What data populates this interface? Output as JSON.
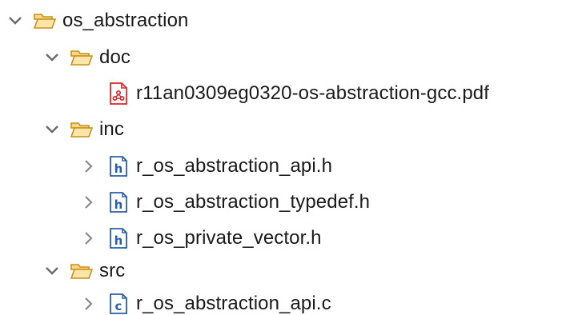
{
  "tree": {
    "root": {
      "name": "os_abstraction",
      "expanded": true,
      "icon": "folder-open-icon",
      "children": [
        {
          "name": "doc",
          "expanded": true,
          "icon": "folder-open-icon",
          "children": [
            {
              "name": "r11an0309eg0320-os-abstraction-gcc.pdf",
              "icon": "pdf-file-icon"
            }
          ]
        },
        {
          "name": "inc",
          "expanded": true,
          "icon": "folder-open-icon",
          "children": [
            {
              "name": "r_os_abstraction_api.h",
              "expanded": false,
              "icon": "h-file-icon"
            },
            {
              "name": "r_os_abstraction_typedef.h",
              "expanded": false,
              "icon": "h-file-icon"
            },
            {
              "name": "r_os_private_vector.h",
              "expanded": false,
              "icon": "h-file-icon"
            }
          ]
        },
        {
          "name": "src",
          "expanded": true,
          "icon": "folder-open-icon",
          "children": [
            {
              "name": "r_os_abstraction_api.c",
              "expanded": false,
              "icon": "c-file-icon"
            }
          ]
        }
      ]
    }
  },
  "colors": {
    "chevron": "#6b6b6b",
    "folder_fill": "#f7d889",
    "folder_stroke": "#c98f1c",
    "pdf_red": "#d9262b",
    "header_blue": "#2a5da8"
  }
}
